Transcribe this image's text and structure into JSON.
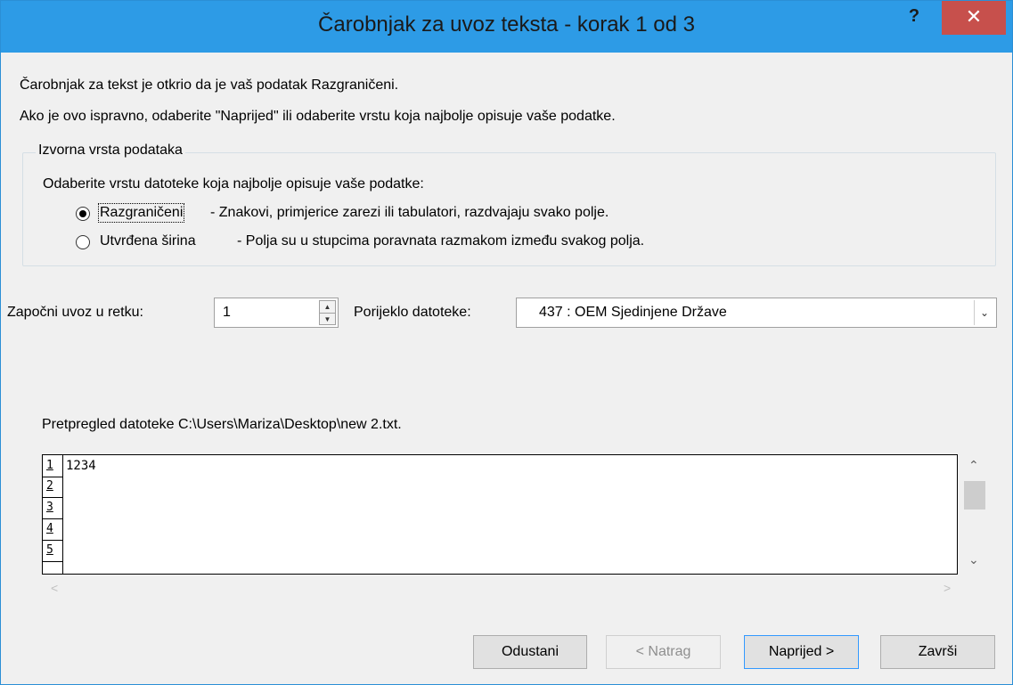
{
  "window": {
    "title": "Čarobnjak za uvoz teksta - korak 1 od 3",
    "help_label": "?",
    "close_label": "✕"
  },
  "intro": {
    "line1": "Čarobnjak za tekst je otkrio da je vaš podatak Razgraničeni.",
    "line2": "Ako je ovo ispravno, odaberite \"Naprijed\" ili odaberite vrstu koja najbolje opisuje vaše podatke."
  },
  "source_group": {
    "title": "Izvorna vrsta podataka",
    "prompt": "Odaberite vrstu datoteke koja najbolje opisuje vaše podatke:",
    "options": [
      {
        "label": "Razgraničeni",
        "description": "- Znakovi, primjerice zarezi ili tabulatori, razdvajaju svako polje.",
        "selected": true
      },
      {
        "label": "Utvrđena širina",
        "description": "- Polja su u stupcima poravnata razmakom između svakog polja.",
        "selected": false
      }
    ]
  },
  "start_row": {
    "label": "Započni uvoz u retku:",
    "value": "1"
  },
  "file_origin": {
    "label": "Porijeklo datoteke:",
    "value": "437 : OEM Sjedinjene Države"
  },
  "preview": {
    "title": "Pretpregled datoteke C:\\Users\\Mariza\\Desktop\\new  2.txt.",
    "row_numbers": [
      "1",
      "2",
      "3",
      "4",
      "5"
    ],
    "lines": [
      "1234"
    ]
  },
  "buttons": {
    "cancel": "Odustani",
    "back": "< Natrag",
    "next": "Naprijed >",
    "finish": "Završi"
  },
  "colors": {
    "titlebar": "#2d9be6",
    "close": "#c7504c",
    "dialog_bg": "#f0f0f0"
  }
}
